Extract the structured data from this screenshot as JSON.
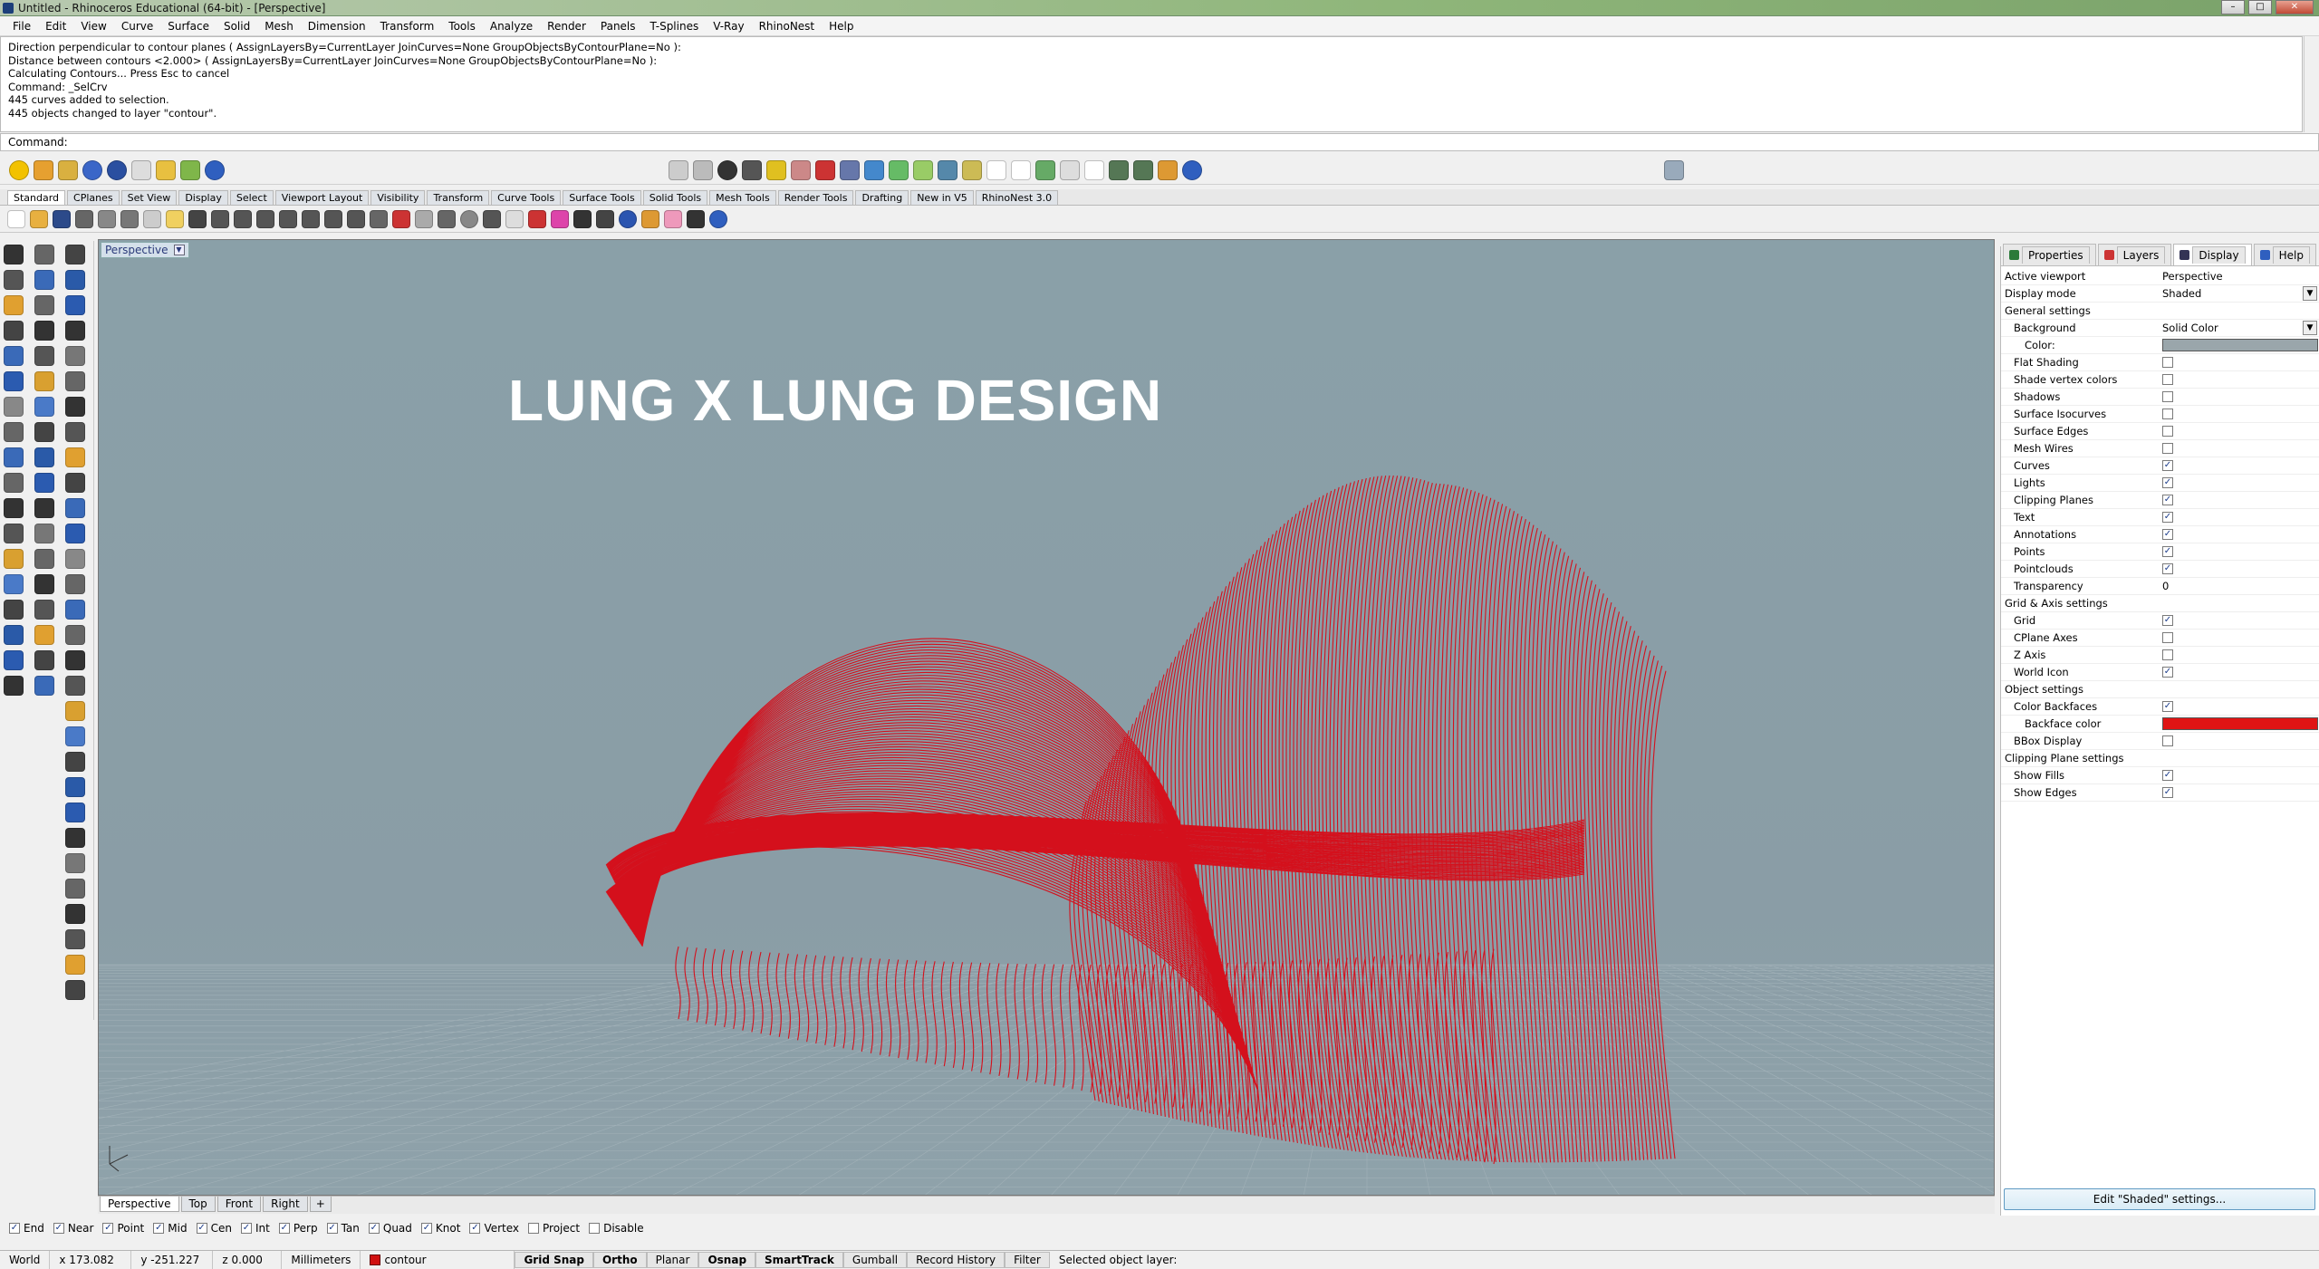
{
  "window": {
    "title": "Untitled - Rhinoceros Educational (64-bit) - [Perspective]",
    "min": "–",
    "max": "□",
    "close": "✕"
  },
  "menu": [
    "File",
    "Edit",
    "View",
    "Curve",
    "Surface",
    "Solid",
    "Mesh",
    "Dimension",
    "Transform",
    "Tools",
    "Analyze",
    "Render",
    "Panels",
    "T-Splines",
    "V-Ray",
    "RhinoNest",
    "Help"
  ],
  "history": [
    "Direction perpendicular to contour planes ( AssignLayersBy=CurrentLayer  JoinCurves=None  GroupObjectsByContourPlane=No ):",
    "Distance between contours <2.000> ( AssignLayersBy=CurrentLayer  JoinCurves=None  GroupObjectsByContourPlane=No ):",
    "Calculating Contours... Press Esc to cancel",
    "Command: _SelCrv",
    "445 curves added to selection.",
    "445 objects changed to layer \"contour\"."
  ],
  "command": {
    "label": "Command:",
    "value": ""
  },
  "toolbar_tabs": [
    "Standard",
    "CPlanes",
    "Set View",
    "Display",
    "Select",
    "Viewport Layout",
    "Visibility",
    "Transform",
    "Curve Tools",
    "Surface Tools",
    "Solid Tools",
    "Mesh Tools",
    "Render Tools",
    "Drafting",
    "New in V5",
    "RhinoNest 3.0"
  ],
  "viewport": {
    "name": "Perspective",
    "overlay_title": "LUNG X LUNG DESIGN",
    "curve_color": "#d4101c"
  },
  "viewport_tabs": [
    "Perspective",
    "Top",
    "Front",
    "Right",
    "+"
  ],
  "osnap": [
    {
      "label": "End",
      "checked": true
    },
    {
      "label": "Near",
      "checked": true
    },
    {
      "label": "Point",
      "checked": true
    },
    {
      "label": "Mid",
      "checked": true
    },
    {
      "label": "Cen",
      "checked": true
    },
    {
      "label": "Int",
      "checked": true
    },
    {
      "label": "Perp",
      "checked": true
    },
    {
      "label": "Tan",
      "checked": true
    },
    {
      "label": "Quad",
      "checked": true
    },
    {
      "label": "Knot",
      "checked": true
    },
    {
      "label": "Vertex",
      "checked": true
    },
    {
      "label": "Project",
      "checked": false
    },
    {
      "label": "Disable",
      "checked": false
    }
  ],
  "status": {
    "cplane": "World",
    "x": "x 173.082",
    "y": "y -251.227",
    "z": "z 0.000",
    "units": "Millimeters",
    "layer": "contour",
    "buttons": [
      "Grid Snap",
      "Ortho",
      "Planar",
      "Osnap",
      "SmartTrack",
      "Gumball",
      "Record History",
      "Filter"
    ],
    "message": "Selected object layer:"
  },
  "panel": {
    "tabs": [
      "Properties",
      "Layers",
      "Display",
      "Help"
    ],
    "rows": [
      {
        "key": "Active viewport",
        "value": "Perspective"
      },
      {
        "key": "Display mode",
        "value": "Shaded",
        "drop": true
      },
      {
        "section": "General settings"
      },
      {
        "key": "Background",
        "value": "Solid Color",
        "drop": true,
        "indent": 1
      },
      {
        "key": "Color:",
        "swatch": "#9aa6ab",
        "indent": 2
      },
      {
        "key": "Flat Shading",
        "check": false,
        "indent": 1
      },
      {
        "key": "Shade vertex colors",
        "check": false,
        "indent": 1
      },
      {
        "key": "Shadows",
        "check": false,
        "indent": 1
      },
      {
        "key": "Surface Isocurves",
        "check": false,
        "indent": 1
      },
      {
        "key": "Surface Edges",
        "check": false,
        "indent": 1
      },
      {
        "key": "Mesh Wires",
        "check": false,
        "indent": 1
      },
      {
        "key": "Curves",
        "check": true,
        "indent": 1
      },
      {
        "key": "Lights",
        "check": true,
        "indent": 1
      },
      {
        "key": "Clipping Planes",
        "check": true,
        "indent": 1
      },
      {
        "key": "Text",
        "check": true,
        "indent": 1
      },
      {
        "key": "Annotations",
        "check": true,
        "indent": 1
      },
      {
        "key": "Points",
        "check": true,
        "indent": 1
      },
      {
        "key": "Pointclouds",
        "check": true,
        "indent": 1
      },
      {
        "key": "Transparency",
        "value": "0",
        "indent": 1
      },
      {
        "section": "Grid & Axis settings"
      },
      {
        "key": "Grid",
        "check": true,
        "indent": 1
      },
      {
        "key": "CPlane Axes",
        "check": false,
        "indent": 1
      },
      {
        "key": "Z Axis",
        "check": false,
        "indent": 1
      },
      {
        "key": "World Icon",
        "check": true,
        "indent": 1
      },
      {
        "section": "Object settings"
      },
      {
        "key": "Color Backfaces",
        "check": true,
        "indent": 1
      },
      {
        "key": "Backface color",
        "swatch": "#e01414",
        "indent": 2
      },
      {
        "key": "BBox Display",
        "check": false,
        "indent": 1
      },
      {
        "section": "Clipping Plane settings"
      },
      {
        "key": "Show Fills",
        "check": true,
        "indent": 1
      },
      {
        "key": "Show Edges",
        "check": true,
        "indent": 1
      }
    ],
    "edit_button": "Edit \"Shaded\" settings..."
  }
}
